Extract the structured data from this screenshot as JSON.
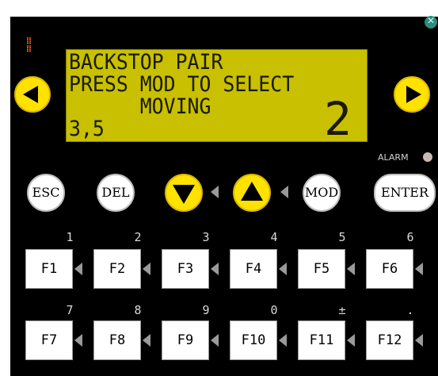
{
  "display": {
    "line1": "BACKSTOP PAIR",
    "line2": "PRESS MOD TO SELECT",
    "line3": "      MOVING",
    "line4": "3,5",
    "big_value": "2"
  },
  "alarm": {
    "label": "ALARM"
  },
  "buttons": {
    "esc": "ESC",
    "del": "DEL",
    "mod": "MOD",
    "enter": "ENTER"
  },
  "fkeys_row1": [
    {
      "label": "F1",
      "num": "1"
    },
    {
      "label": "F2",
      "num": "2"
    },
    {
      "label": "F3",
      "num": "3"
    },
    {
      "label": "F4",
      "num": "4"
    },
    {
      "label": "F5",
      "num": "5"
    },
    {
      "label": "F6",
      "num": "6"
    }
  ],
  "fkeys_row2": [
    {
      "label": "F7",
      "num": "7"
    },
    {
      "label": "F8",
      "num": "8"
    },
    {
      "label": "F9",
      "num": "9"
    },
    {
      "label": "F10",
      "num": "0"
    },
    {
      "label": "F11",
      "num": "±"
    },
    {
      "label": "F12",
      "num": "."
    }
  ],
  "colors": {
    "lcd_bg": "#c8c000",
    "nav_yellow": "#ffe200",
    "panel": "#000000"
  }
}
